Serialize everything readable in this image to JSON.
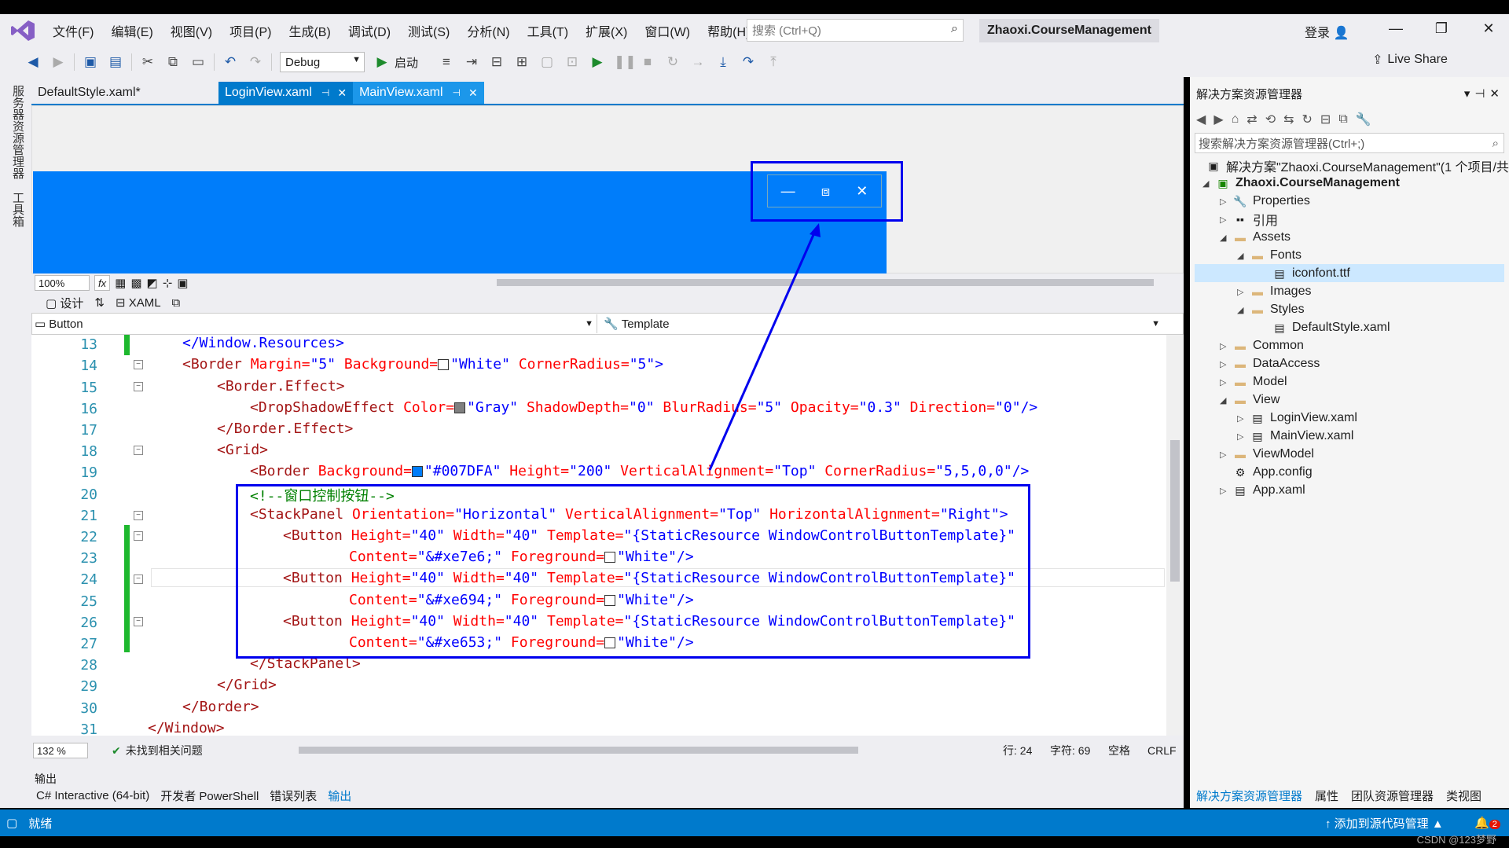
{
  "menu": [
    "文件(F)",
    "编辑(E)",
    "视图(V)",
    "项目(P)",
    "生成(B)",
    "调试(D)",
    "测试(S)",
    "分析(N)",
    "工具(T)",
    "扩展(X)",
    "窗口(W)",
    "帮助(H)"
  ],
  "search_placeholder": "搜索 (Ctrl+Q)",
  "app_title": "Zhaoxi.CourseManagement",
  "login": "登录",
  "toolbar": {
    "config": "Debug",
    "start": "启动",
    "live_share": "Live Share"
  },
  "left_strip": [
    "服务器资源管理器",
    "工具箱"
  ],
  "tabs": [
    {
      "label": "DefaultStyle.xaml*"
    },
    {
      "label": "LoginView.xaml"
    },
    {
      "label": "MainView.xaml"
    }
  ],
  "design": {
    "zoom": "100%",
    "fx": "fx"
  },
  "split": {
    "design": "设计",
    "xaml": "XAML"
  },
  "nav": {
    "left": "Button",
    "right": "Template"
  },
  "code": {
    "line_numbers": [
      "13",
      "14",
      "15",
      "16",
      "17",
      "18",
      "19",
      "20",
      "21",
      "22",
      "23",
      "24",
      "25",
      "26",
      "27",
      "28",
      "29",
      "30",
      "31"
    ],
    "l13": "</Window.Resources>",
    "l14_tag": "<Border",
    "l14_a1": " Margin=",
    "l14_v1": "\"5\"",
    "l14_a2": " Background=",
    "l14_v2": "\"White\"",
    "l14_a3": " CornerRadius=",
    "l14_v3": "\"5\"",
    "l14_end": ">",
    "l15": "<Border.Effect>",
    "l16_tag": "<DropShadowEffect",
    "l16_a1": " Color=",
    "l16_v1": "\"Gray\"",
    "l16_a2": " ShadowDepth=",
    "l16_v2": "\"0\"",
    "l16_a3": " BlurRadius=",
    "l16_v3": "\"5\"",
    "l16_a4": " Opacity=",
    "l16_v4": "\"0.3\"",
    "l16_a5": " Direction=",
    "l16_v5": "\"0\"",
    "l16_end": "/>",
    "l17": "</Border.Effect>",
    "l18": "<Grid>",
    "l19_tag": "<Border",
    "l19_a1": " Background=",
    "l19_v1": "\"#007DFA\"",
    "l19_a2": " Height=",
    "l19_v2": "\"200\"",
    "l19_a3": " VerticalAlignment=",
    "l19_v3": "\"Top\"",
    "l19_a4": " CornerRadius=",
    "l19_v4": "\"5,5,0,0\"",
    "l19_end": "/>",
    "l20": "<!--窗口控制按钮-->",
    "l21_tag": "<StackPanel",
    "l21_a1": " Orientation=",
    "l21_v1": "\"Horizontal\"",
    "l21_a2": " VerticalAlignment=",
    "l21_v2": "\"Top\"",
    "l21_a3": " HorizontalAlignment=",
    "l21_v3": "\"Right\"",
    "l21_end": ">",
    "btn_tag": "<Button",
    "btn_a1": " Height=",
    "btn_v1": "\"40\"",
    "btn_a2": " Width=",
    "btn_v2": "\"40\"",
    "btn_a3": " Template=",
    "btn_v3": "\"{StaticResource WindowControlButtonTemplate}\"",
    "content_a": "Content=",
    "fg_a": " Foreground=",
    "fg_v": "\"White\"",
    "close": "/>",
    "l23_v": "\"&#xe7e6;\"",
    "l25_v": "\"&#xe694;\"",
    "l27_v": "\"&#xe653;\"",
    "l28": "</StackPanel>",
    "l29": "</Grid>",
    "l30": "</Border>",
    "l31": "</Window>"
  },
  "editor_status": {
    "zoom": "132 %",
    "issues": "未找到相关问题",
    "line": "行: 24",
    "col": "字符: 69",
    "spaces": "空格",
    "eol": "CRLF"
  },
  "output": {
    "title": "输出",
    "tabs": [
      "C# Interactive (64-bit)",
      "开发者 PowerShell",
      "错误列表",
      "输出"
    ]
  },
  "solution": {
    "title": "解决方案资源管理器",
    "search": "搜索解决方案资源管理器(Ctrl+;)",
    "root": "解决方案\"Zhaoxi.CourseManagement\"(1 个项目/共",
    "project": "Zhaoxi.CourseManagement",
    "items": [
      "Properties",
      "引用",
      "Assets",
      "Fonts",
      "iconfont.ttf",
      "Images",
      "Styles",
      "DefaultStyle.xaml",
      "Common",
      "DataAccess",
      "Model",
      "View",
      "LoginView.xaml",
      "MainView.xaml",
      "ViewModel",
      "App.config",
      "App.xaml"
    ],
    "bottom_tabs": [
      "解决方案资源管理器",
      "属性",
      "团队资源管理器",
      "类视图"
    ]
  },
  "statusbar": {
    "ready": "就绪",
    "source_control": "添加到源代码管理",
    "notif": "2",
    "watermark": "CSDN @123梦野"
  },
  "colors": {
    "accent": "#007acc",
    "design_blue": "#007dfa",
    "annotation": "#0000ee"
  }
}
